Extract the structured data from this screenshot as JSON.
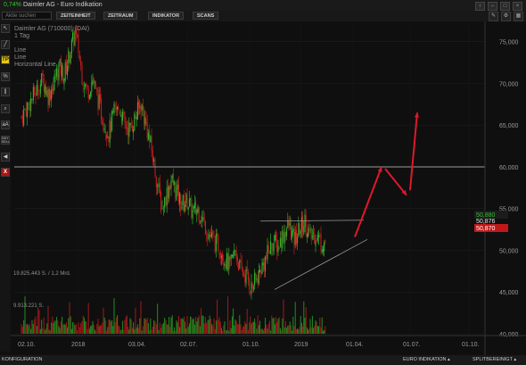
{
  "window": {
    "change_pct": "0,74%",
    "title": "Daimler AG - Euro Indikation",
    "controls": [
      "‹",
      "–",
      "□",
      "×"
    ]
  },
  "toolbar": {
    "search_placeholder": "Aktie suchen",
    "buttons": [
      "ZEITEINHEIT",
      "ZEITRAUM",
      "INDIKATOR",
      "SCANS"
    ]
  },
  "leftbar": {
    "tools": [
      "cursor",
      "line",
      "TP",
      "%",
      "channel",
      "zoom",
      "aA",
      "BUY SELL",
      "sound",
      "X"
    ]
  },
  "chart": {
    "instrument": "Daimler AG (710000) (DAI)",
    "period": "1 Tag",
    "drawings": [
      "Line",
      "Line",
      "Horizontal Line"
    ],
    "volume_label_1": "19.825.443 S. / 1,2 Mrd.",
    "volume_label_2": "9.913.221 S.",
    "price_ticks": [
      "75,000",
      "70,000",
      "65,000",
      "60,000",
      "55,000",
      "50,000",
      "45,000",
      "40,000"
    ],
    "date_ticks": [
      "02.10.",
      "2018",
      "03.04.",
      "02.07.",
      "01.10.",
      "2019",
      "01.04.",
      "01.07.",
      "01.10."
    ],
    "last_prices": {
      "high": "50,880",
      "mid": "50,876",
      "low": "50,870"
    },
    "colors": {
      "up": "#2fbf2f",
      "down": "#d21f1f",
      "annotation": "#e0182b",
      "resistance": "#c9c9c9"
    }
  },
  "chart_data": {
    "type": "candlestick",
    "title": "Daimler AG (710000) (DAI)",
    "ylim": [
      40,
      77
    ],
    "x_labels": [
      "02.10.",
      "2018",
      "03.04.",
      "02.07.",
      "01.10.",
      "2019",
      "01.04.",
      "01.07.",
      "01.10."
    ],
    "key_levels": {
      "horizontal_line": 60.0,
      "triangle_top": 53.5
    },
    "price_path": [
      [
        0,
        66.0
      ],
      [
        8,
        67.5
      ],
      [
        16,
        69.0
      ],
      [
        24,
        70.5
      ],
      [
        30,
        68.5
      ],
      [
        36,
        70.0
      ],
      [
        42,
        72.0
      ],
      [
        48,
        71.0
      ],
      [
        54,
        73.5
      ],
      [
        60,
        76.0
      ],
      [
        64,
        74.0
      ],
      [
        68,
        71.0
      ],
      [
        74,
        69.0
      ],
      [
        80,
        70.5
      ],
      [
        86,
        68.0
      ],
      [
        92,
        65.5
      ],
      [
        98,
        64.0
      ],
      [
        104,
        66.5
      ],
      [
        110,
        67.0
      ],
      [
        116,
        65.0
      ],
      [
        122,
        64.5
      ],
      [
        128,
        66.0
      ],
      [
        134,
        67.5
      ],
      [
        140,
        65.0
      ],
      [
        146,
        62.0
      ],
      [
        150,
        59.5
      ],
      [
        154,
        57.0
      ],
      [
        158,
        55.0
      ],
      [
        162,
        56.5
      ],
      [
        168,
        58.5
      ],
      [
        174,
        57.0
      ],
      [
        180,
        55.5
      ],
      [
        186,
        56.0
      ],
      [
        192,
        54.5
      ],
      [
        198,
        55.0
      ],
      [
        204,
        53.5
      ],
      [
        210,
        52.0
      ],
      [
        216,
        51.0
      ],
      [
        222,
        50.5
      ],
      [
        228,
        49.0
      ],
      [
        234,
        48.0
      ],
      [
        240,
        50.0
      ],
      [
        246,
        47.5
      ],
      [
        252,
        47.0
      ],
      [
        258,
        45.5
      ],
      [
        264,
        46.5
      ],
      [
        270,
        48.0
      ],
      [
        276,
        49.5
      ],
      [
        282,
        51.0
      ],
      [
        288,
        50.5
      ],
      [
        294,
        52.0
      ],
      [
        300,
        53.0
      ],
      [
        306,
        51.0
      ],
      [
        312,
        52.5
      ],
      [
        318,
        53.5
      ],
      [
        324,
        51.5
      ],
      [
        330,
        52.0
      ],
      [
        336,
        51.0
      ],
      [
        342,
        50.9
      ]
    ],
    "volume_series": "daily volume bars"
  }
}
